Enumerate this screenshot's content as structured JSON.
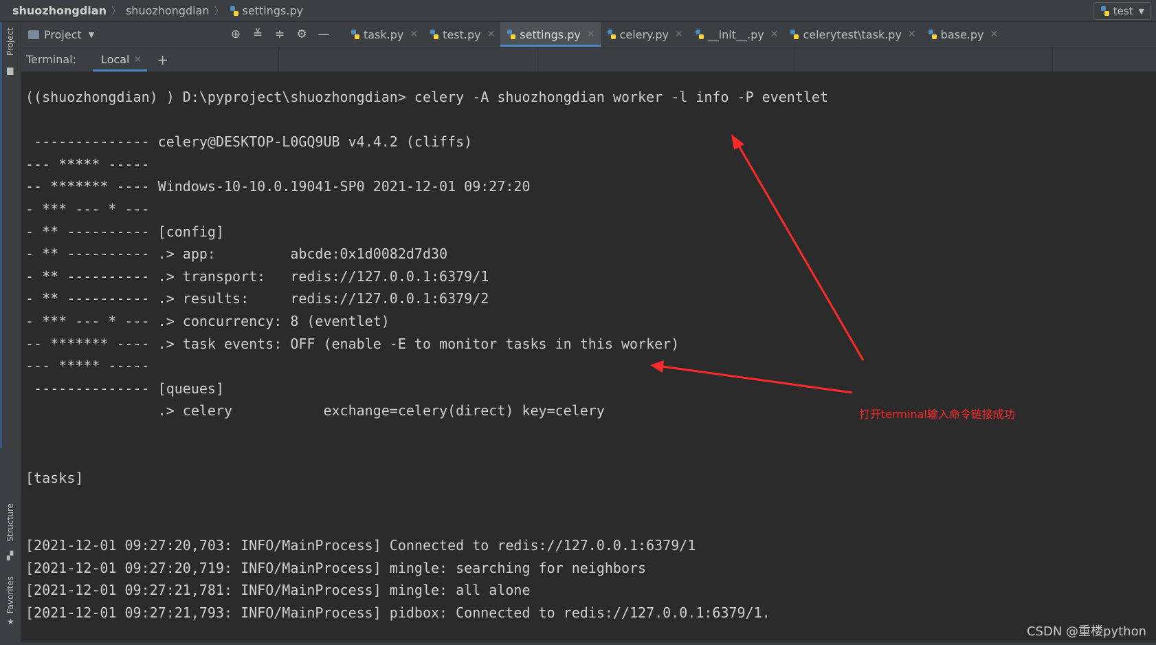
{
  "navbar": {
    "crumbs": [
      "shuozhongdian",
      "shuozhongdian",
      "settings.py"
    ],
    "run_config": "test"
  },
  "left_stripe": {
    "project": "Project",
    "structure": "Structure",
    "favorites": "Favorites"
  },
  "toolbar": {
    "project_label": "Project",
    "icons": [
      "crosshair-icon",
      "collapse-all-icon",
      "expand-all-icon",
      "gear-icon",
      "minimize-icon"
    ]
  },
  "tabs": [
    {
      "label": "task.py",
      "active": false
    },
    {
      "label": "test.py",
      "active": false
    },
    {
      "label": "settings.py",
      "active": true
    },
    {
      "label": "celery.py",
      "active": false
    },
    {
      "label": "__init__.py",
      "active": false
    },
    {
      "label": "celerytest\\task.py",
      "active": false
    },
    {
      "label": "base.py",
      "active": false
    }
  ],
  "terminal": {
    "title": "Terminal:",
    "tab_label": "Local",
    "lines": [
      "((shuozhongdian) ) D:\\pyproject\\shuozhongdian> celery -A shuozhongdian worker -l info -P eventlet",
      "",
      " -------------- celery@DESKTOP-L0GQ9UB v4.4.2 (cliffs)",
      "--- ***** -----",
      "-- ******* ---- Windows-10-10.0.19041-SP0 2021-12-01 09:27:20",
      "- *** --- * ---",
      "- ** ---------- [config]",
      "- ** ---------- .> app:         abcde:0x1d0082d7d30",
      "- ** ---------- .> transport:   redis://127.0.0.1:6379/1",
      "- ** ---------- .> results:     redis://127.0.0.1:6379/2",
      "- *** --- * --- .> concurrency: 8 (eventlet)",
      "-- ******* ---- .> task events: OFF (enable -E to monitor tasks in this worker)",
      "--- ***** -----",
      " -------------- [queues]",
      "                .> celery           exchange=celery(direct) key=celery",
      "",
      "",
      "[tasks]",
      "",
      "",
      "[2021-12-01 09:27:20,703: INFO/MainProcess] Connected to redis://127.0.0.1:6379/1",
      "[2021-12-01 09:27:20,719: INFO/MainProcess] mingle: searching for neighbors",
      "[2021-12-01 09:27:21,781: INFO/MainProcess] mingle: all alone",
      "[2021-12-01 09:27:21,793: INFO/MainProcess] pidbox: Connected to redis://127.0.0.1:6379/1."
    ]
  },
  "annotation": "打开terminal输入命令链接成功",
  "watermark": "CSDN @重楼python",
  "colors": {
    "background": "#2b2b2b",
    "panel": "#3c3f41",
    "accent": "#4a88c7",
    "annotation": "#ff2a2a"
  }
}
